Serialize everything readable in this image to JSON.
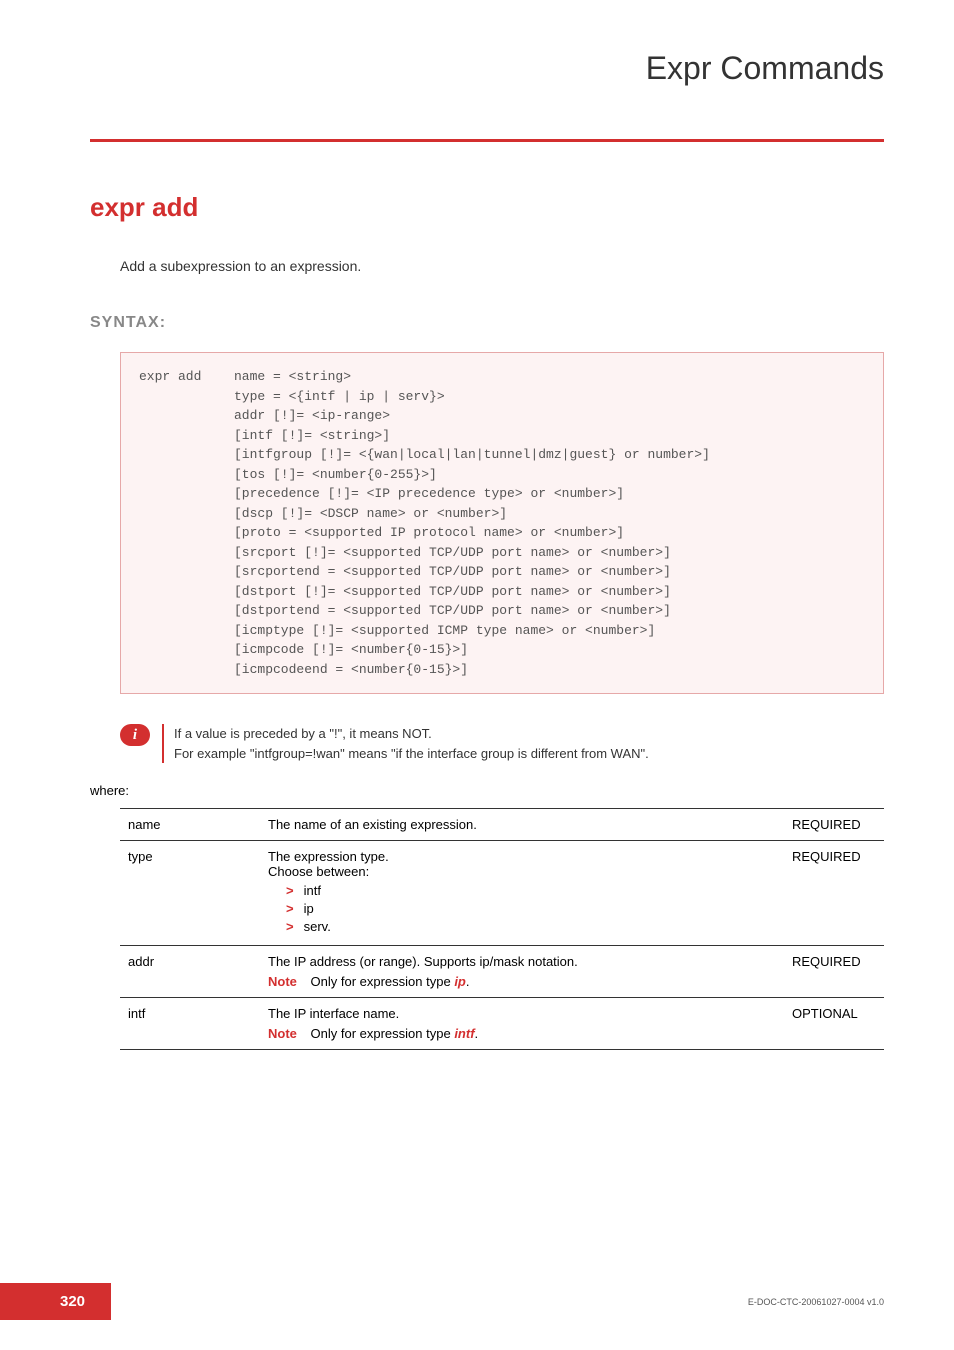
{
  "chapter_title": "Expr Commands",
  "command_title": "expr add",
  "command_description": "Add a subexpression to an expression.",
  "syntax_section_label": "SYNTAX:",
  "syntax_command": "expr add",
  "syntax_lines": "name = <string>\ntype = <{intf | ip | serv}>\naddr [!]= <ip-range>\n[intf [!]= <string>]\n[intfgroup [!]= <{wan|local|lan|tunnel|dmz|guest} or number>]\n[tos [!]= <number{0-255}>]\n[precedence [!]= <IP precedence type> or <number>]\n[dscp [!]= <DSCP name> or <number>]\n[proto = <supported IP protocol name> or <number>]\n[srcport [!]= <supported TCP/UDP port name> or <number>]\n[srcportend = <supported TCP/UDP port name> or <number>]\n[dstport [!]= <supported TCP/UDP port name> or <number>]\n[dstportend = <supported TCP/UDP port name> or <number>]\n[icmptype [!]= <supported ICMP type name> or <number>]\n[icmpcode [!]= <number{0-15}>]\n[icmpcodeend = <number{0-15}>]",
  "info_note_line1": "If a value is preceded by a \"!\", it means NOT.",
  "info_note_line2": "For example \"intfgroup=!wan\" means \"if the interface group is different from WAN\".",
  "where_label": "where:",
  "note_label": "Note",
  "params": {
    "name": {
      "label": "name",
      "desc": "The name of an existing expression.",
      "req": "REQUIRED"
    },
    "type": {
      "label": "type",
      "desc_line1": "The expression type.",
      "desc_line2": "Choose between:",
      "bullet1": "intf",
      "bullet2": "ip",
      "bullet3": "serv.",
      "req": "REQUIRED"
    },
    "addr": {
      "label": "addr",
      "desc": "The IP address (or range). Supports ip/mask notation.",
      "note_prefix": "Only for expression type ",
      "note_em": "ip",
      "note_suffix": ".",
      "req": "REQUIRED"
    },
    "intf": {
      "label": "intf",
      "desc": "The IP interface name.",
      "note_prefix": "Only for expression type ",
      "note_em": "intf",
      "note_suffix": ".",
      "req": "OPTIONAL"
    }
  },
  "footer": {
    "page_number": "320",
    "doc_id": "E-DOC-CTC-20061027-0004 v1.0"
  }
}
